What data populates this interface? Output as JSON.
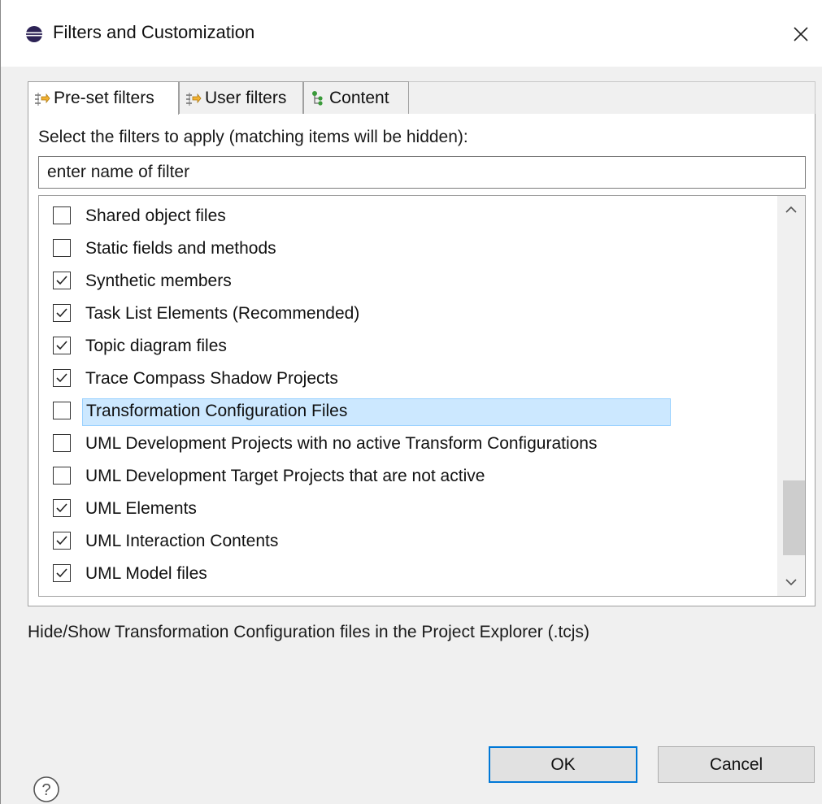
{
  "window": {
    "title": "Filters and Customization",
    "icon": "eclipse-icon"
  },
  "tabs": [
    {
      "label": "Pre-set filters",
      "icon": "filter-icon",
      "active": true
    },
    {
      "label": "User filters",
      "icon": "filter-icon",
      "active": false
    },
    {
      "label": "Content",
      "icon": "content-tree-icon",
      "active": false
    }
  ],
  "instructions": "Select the filters to apply (matching items will be hidden):",
  "filter_input": {
    "value": "enter name of filter"
  },
  "filters": [
    {
      "label": "Shared object files",
      "checked": false,
      "selected": false
    },
    {
      "label": "Static fields and methods",
      "checked": false,
      "selected": false
    },
    {
      "label": "Synthetic members",
      "checked": true,
      "selected": false
    },
    {
      "label": "Task List Elements (Recommended)",
      "checked": true,
      "selected": false
    },
    {
      "label": "Topic diagram files",
      "checked": true,
      "selected": false
    },
    {
      "label": "Trace Compass Shadow Projects",
      "checked": true,
      "selected": false
    },
    {
      "label": "Transformation Configuration Files",
      "checked": false,
      "selected": true
    },
    {
      "label": "UML Development Projects with no active Transform Configurations",
      "checked": false,
      "selected": false
    },
    {
      "label": "UML Development Target Projects that are not active",
      "checked": false,
      "selected": false
    },
    {
      "label": "UML Elements",
      "checked": true,
      "selected": false
    },
    {
      "label": "UML Interaction Contents",
      "checked": true,
      "selected": false
    },
    {
      "label": "UML Model files",
      "checked": true,
      "selected": false
    }
  ],
  "description": "Hide/Show Transformation Configuration files in the Project Explorer (.tcjs)",
  "buttons": {
    "ok_label": "OK",
    "cancel_label": "Cancel"
  },
  "colors": {
    "selection_bg": "#cce8ff",
    "default_button_border": "#0078d7"
  }
}
